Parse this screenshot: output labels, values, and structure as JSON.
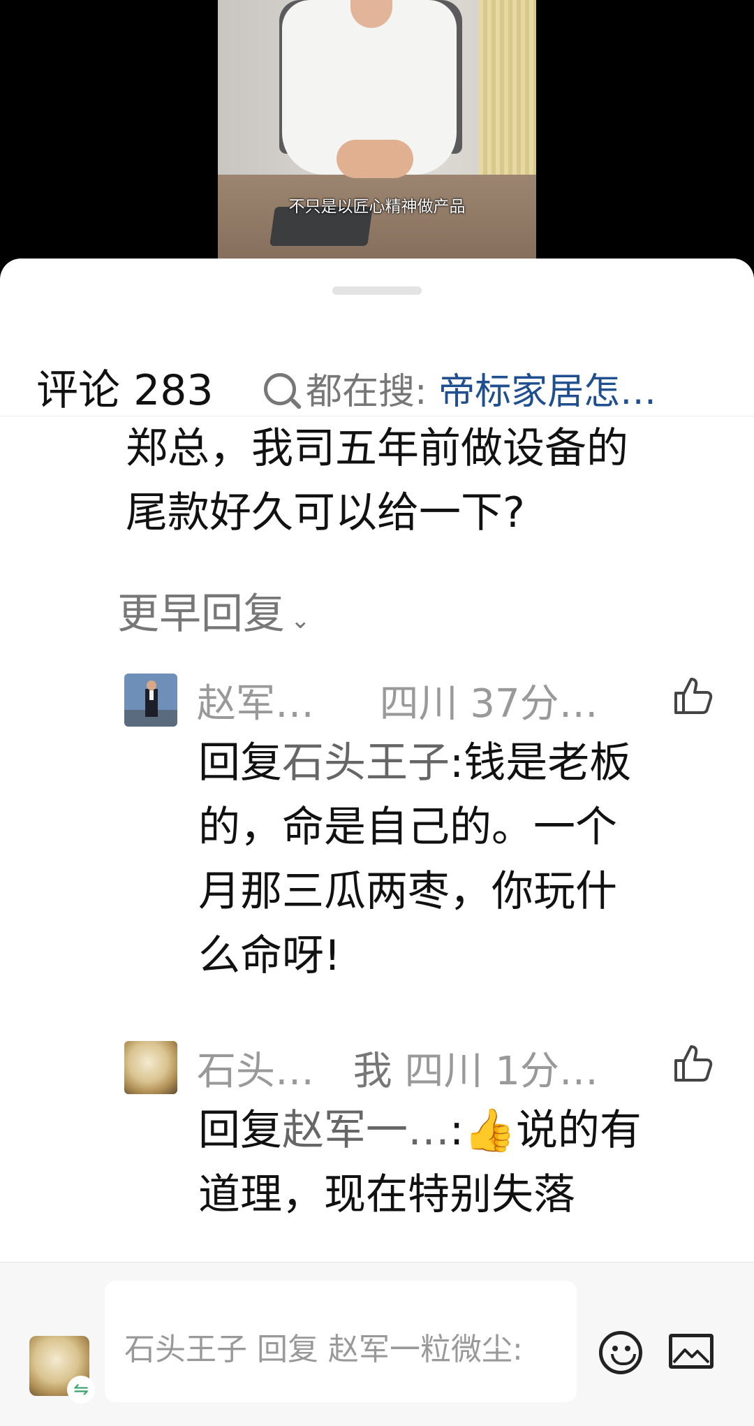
{
  "video": {
    "subtitle": "不只是以匠心精神做产品"
  },
  "header": {
    "title": "评论 283",
    "search_prefix": "都在搜:",
    "search_query": "帝标家居怎…"
  },
  "top_comment": {
    "text_line1": "郑总，我司五年前做设备的",
    "text_line2": "尾款好久可以给一下?"
  },
  "earlier_replies": {
    "label": "更早回复",
    "chevron": "⌄"
  },
  "replies": [
    {
      "author": "赵军…",
      "location_time": "四川 37分…",
      "reply_prefix": "回复",
      "mention": "石头王子",
      "text_line1_rest": ":钱是老板",
      "text_line2": "的，命是自己的。一个",
      "text_line3": "月那三瓜两枣，你玩什",
      "text_line4": "么命呀!"
    },
    {
      "author": "石头…",
      "me_tag": "我",
      "location_time": "四川 1分…",
      "reply_prefix": "回复",
      "mention": "赵军一…",
      "text_line1_rest": ":",
      "emoji": "👍",
      "text_line1_tail": "说的有",
      "text_line2": "道理，现在特别失落"
    }
  ],
  "input": {
    "placeholder": "石头王子 回复 赵军一粒微尘:",
    "badge": "⇋"
  }
}
